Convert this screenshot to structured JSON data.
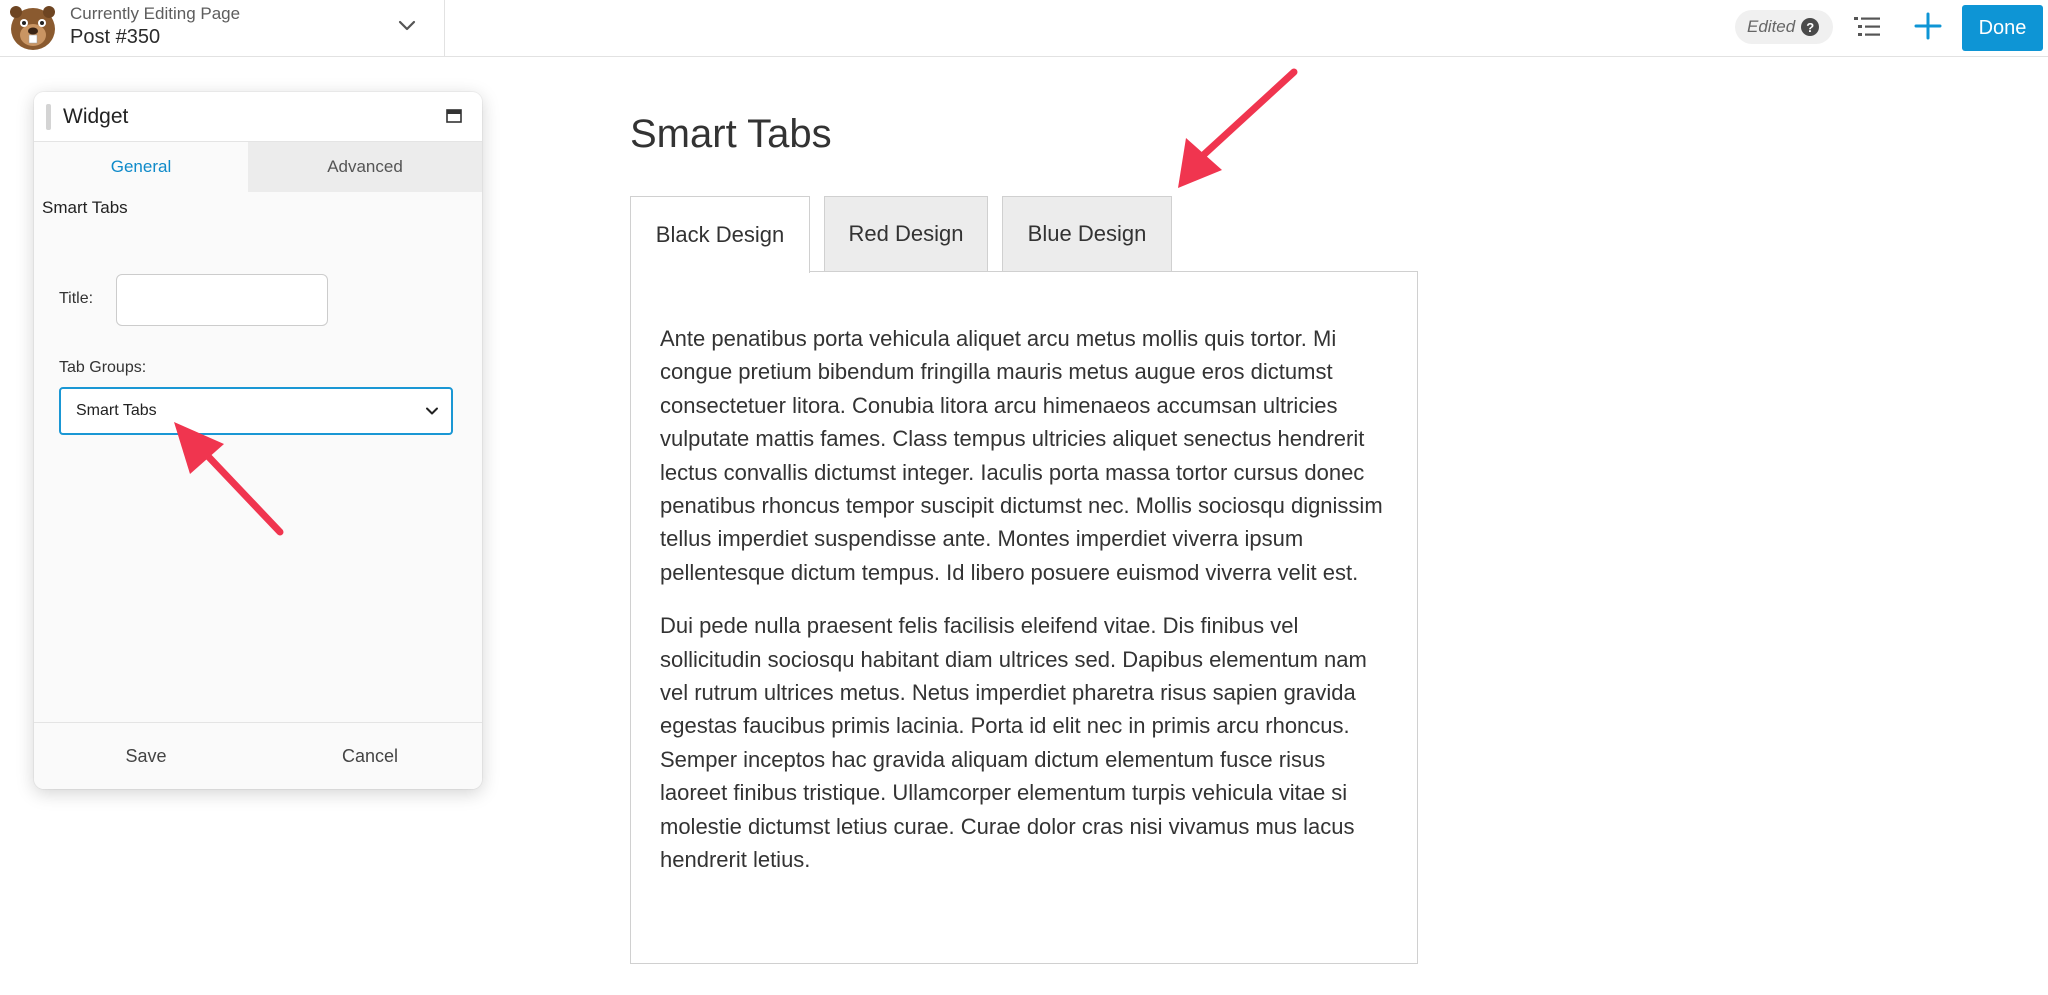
{
  "topbar": {
    "editing_label": "Currently Editing Page",
    "editing_title": "Post #350",
    "status_badge": "Edited",
    "help_glyph": "?",
    "done_label": "Done",
    "icons": [
      "beaver-logo",
      "chevron-down-icon",
      "help-icon",
      "outline-list-icon",
      "plus-icon"
    ]
  },
  "panel": {
    "title": "Widget",
    "tabs": [
      "General",
      "Advanced"
    ],
    "active_tab": "General",
    "section_title": "Smart Tabs",
    "title_field": {
      "label": "Title:",
      "value": ""
    },
    "tab_groups_field": {
      "label": "Tab Groups:",
      "value": "Smart Tabs"
    },
    "save_label": "Save",
    "cancel_label": "Cancel"
  },
  "content": {
    "heading": "Smart Tabs",
    "tabs": [
      "Black Design",
      "Red Design",
      "Blue Design"
    ],
    "active_tab": "Black Design",
    "paragraphs": [
      "Ante penatibus porta vehicula aliquet arcu metus mollis quis tortor. Mi congue pretium bibendum fringilla mauris metus augue eros dictumst consectetuer litora. Conubia litora arcu himenaeos accumsan ultricies vulputate mattis fames. Class tempus ultricies aliquet senectus hendrerit lectus convallis dictumst integer. Iaculis porta massa tortor cursus donec penatibus rhoncus tempor suscipit dictumst nec. Mollis sociosqu dignissim tellus imperdiet suspendisse ante. Montes imperdiet viverra ipsum pellentesque dictum tempus. Id libero posuere euismod viverra velit est.",
      "Dui pede nulla praesent felis facilisis eleifend vitae. Dis finibus vel sollicitudin sociosqu habitant diam ultrices sed. Dapibus elementum nam vel rutrum ultrices metus. Netus imperdiet pharetra risus sapien gravida egestas faucibus primis lacinia. Porta id elit nec in primis arcu rhoncus. Semper inceptos hac gravida aliquam dictum elementum fusce risus laoreet finibus tristique. Ullamcorper elementum turpis vehicula vitae si molestie dictumst letius curae. Curae dolor cras nisi vivamus mus lacus hendrerit letius."
    ]
  },
  "colors": {
    "accent": "#0e95d5",
    "annotation_arrow": "#f0354f"
  }
}
